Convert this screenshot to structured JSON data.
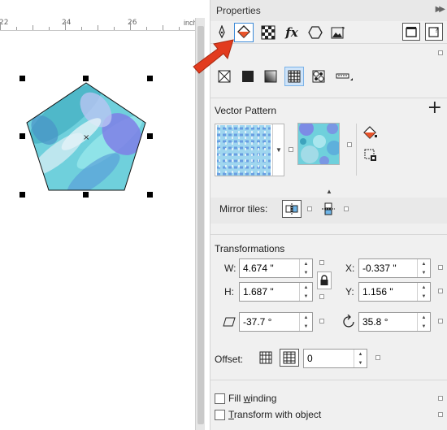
{
  "ruler": {
    "ticks": [
      "22",
      "24",
      "26"
    ],
    "unit": "inches"
  },
  "panel": {
    "title": "Properties"
  },
  "tabs": [
    "pen-tab",
    "fill-tab",
    "transparency-tab",
    "effects-tab",
    "shape-tab",
    "image-tab"
  ],
  "vector_pattern": {
    "heading": "Vector Pattern"
  },
  "mirror": {
    "label": "Mirror tiles:"
  },
  "transformations": {
    "heading": "Transformations",
    "w_label": "W:",
    "w_value": "4.674 \"",
    "h_label": "H:",
    "h_value": "1.687 \"",
    "x_label": "X:",
    "x_value": "-0.337 \"",
    "y_label": "Y:",
    "y_value": "1.156 \"",
    "skew_value": "-37.7 °",
    "rotate_value": "35.8 °"
  },
  "offset": {
    "label": "Offset:",
    "value": "0"
  },
  "options": {
    "fill_winding": {
      "pre": "Fill ",
      "u": "w",
      "post": "inding"
    },
    "transform_with_object": {
      "pre": "",
      "u": "T",
      "post": "ransform with object"
    }
  },
  "colors": {
    "accent_blue": "#3c8ad8",
    "arrow_red": "#e23b1e",
    "pattern_teal": "#6fd0dc",
    "pattern_purple": "#7f7fe6"
  }
}
